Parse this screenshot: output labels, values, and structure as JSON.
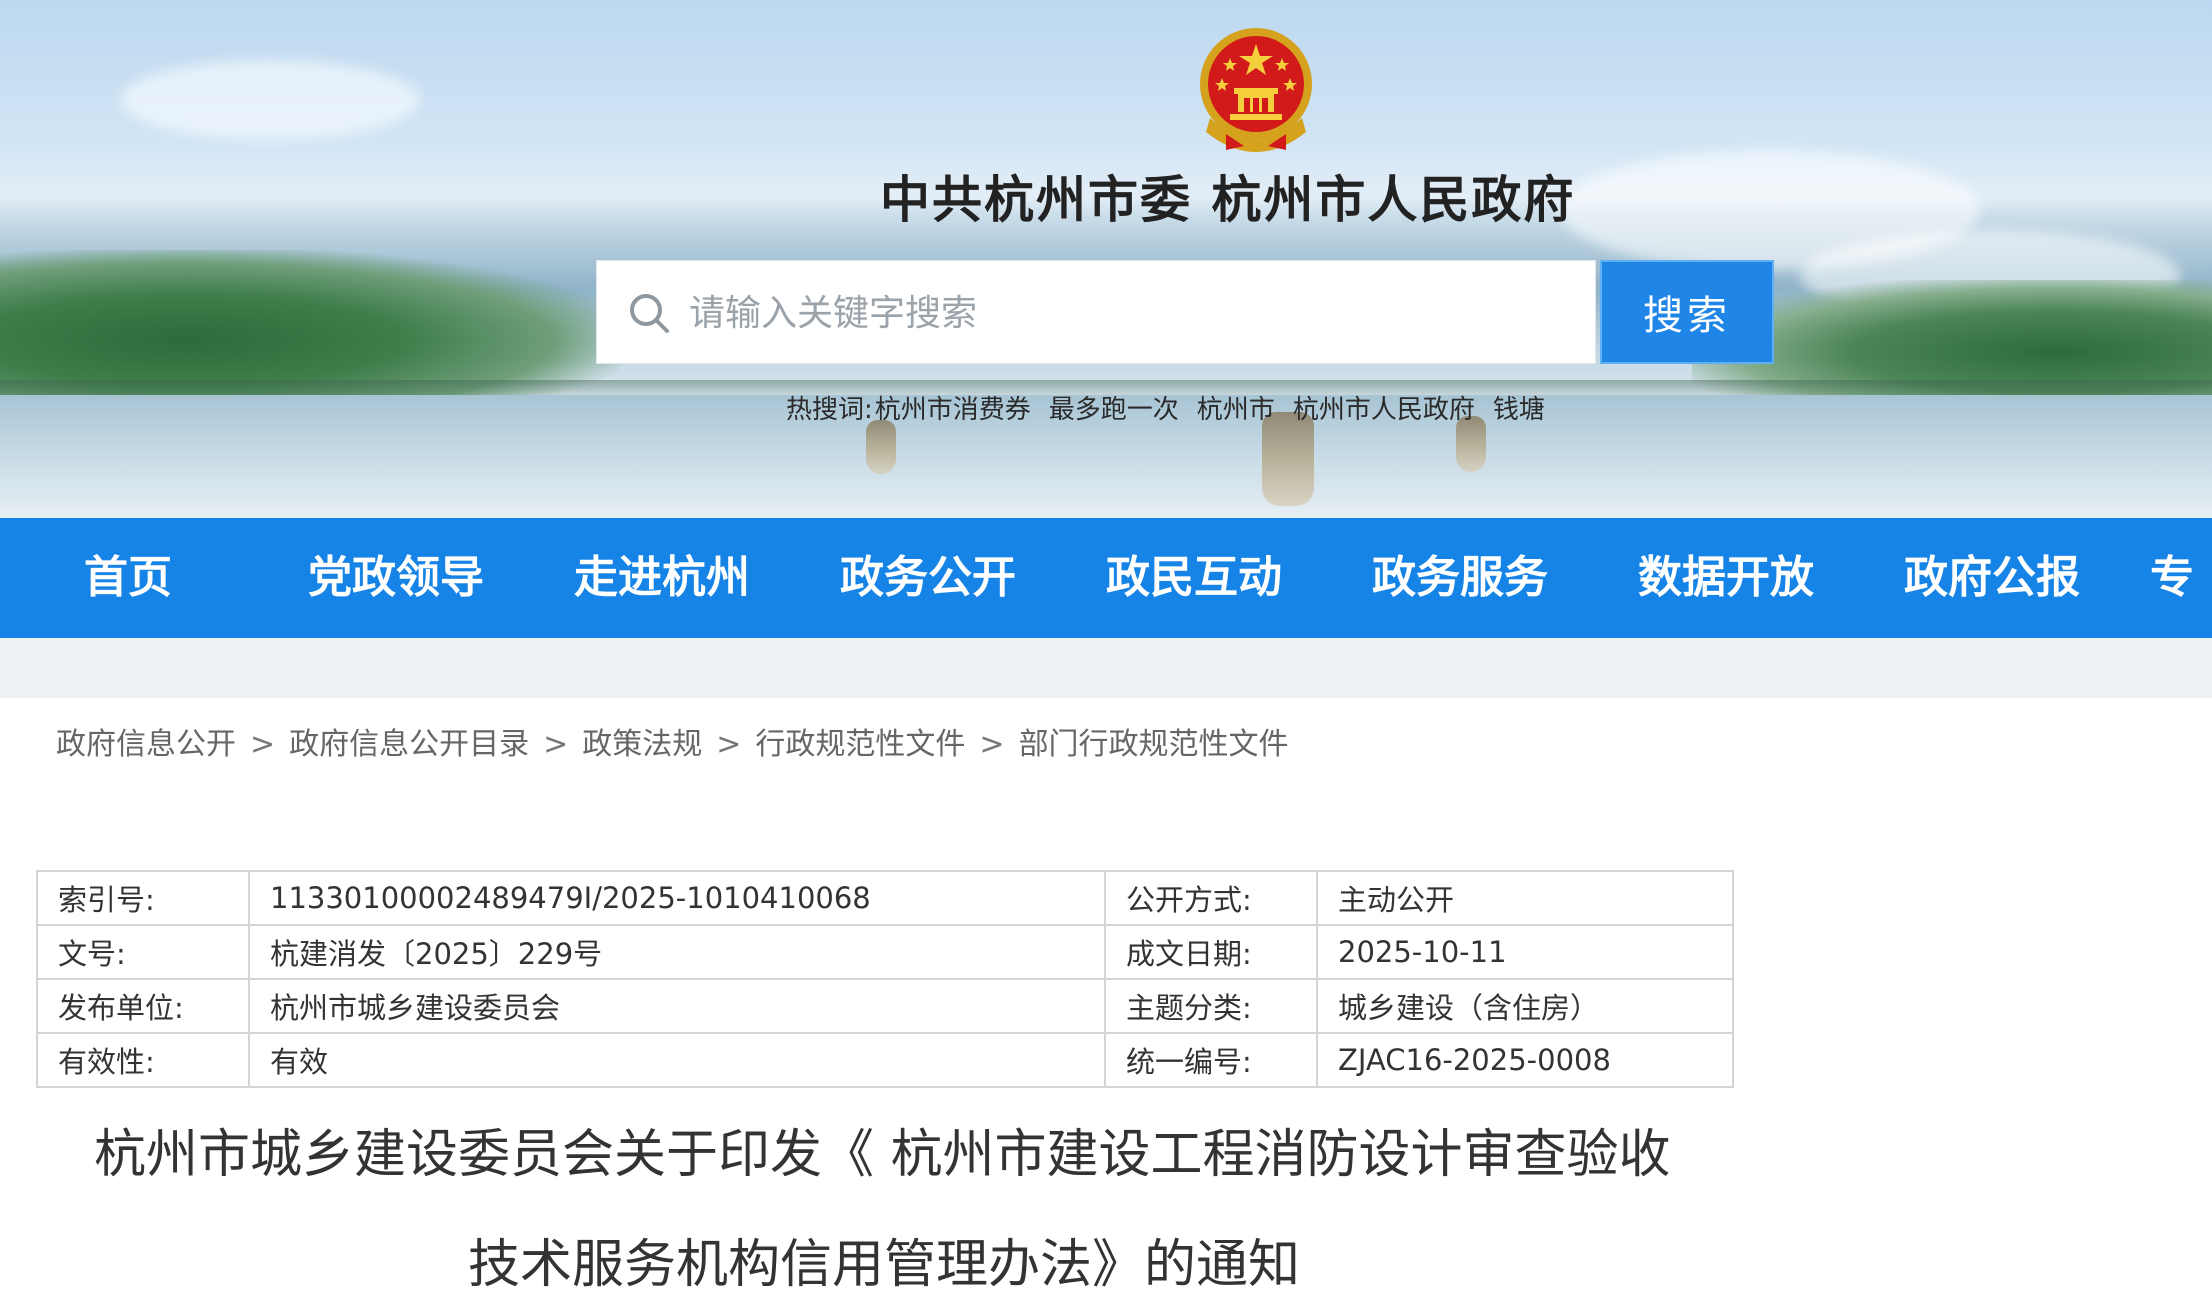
{
  "header": {
    "site_title": "中共杭州市委   杭州市人民政府",
    "emblem_icon": "national-emblem-icon",
    "search": {
      "placeholder": "请输入关键字搜索",
      "button_label": "搜索"
    },
    "hot_search": {
      "label": "热搜词:",
      "items": [
        "杭州市消费券",
        "最多跑一次",
        "杭州市",
        "杭州市人民政府",
        "钱塘"
      ]
    }
  },
  "nav": {
    "items": [
      {
        "label": "首页"
      },
      {
        "label": "党政领导"
      },
      {
        "label": "走进杭州"
      },
      {
        "label": "政务公开"
      },
      {
        "label": "政民互动"
      },
      {
        "label": "政务服务"
      },
      {
        "label": "数据开放"
      },
      {
        "label": "政府公报"
      },
      {
        "label": "专"
      }
    ],
    "background_color": "#1684e6"
  },
  "breadcrumb": {
    "items": [
      "政府信息公开",
      "政府信息公开目录",
      "政策法规",
      "行政规范性文件",
      "部门行政规范性文件"
    ],
    "separator": ">"
  },
  "info_table": {
    "rows": [
      {
        "label1": "索引号:",
        "value1": "11330100002489479I/2025-1010410068",
        "label2": "公开方式:",
        "value2": "主动公开"
      },
      {
        "label1": "文号:",
        "value1": "杭建消发〔2025〕229号",
        "label2": "成文日期:",
        "value2": "2025-10-11"
      },
      {
        "label1": "发布单位:",
        "value1": "杭州市城乡建设委员会",
        "label2": "主题分类:",
        "value2": "城乡建设（含住房）"
      },
      {
        "label1": "有效性:",
        "value1": "有效",
        "label2": "统一编号:",
        "value2": "ZJAC16-2025-0008"
      }
    ]
  },
  "document": {
    "title_line1": "杭州市城乡建设委员会关于印发《 杭州市建设工程消防设计审查验收",
    "title_line2": "技术服务机构信用管理办法》的通知"
  }
}
